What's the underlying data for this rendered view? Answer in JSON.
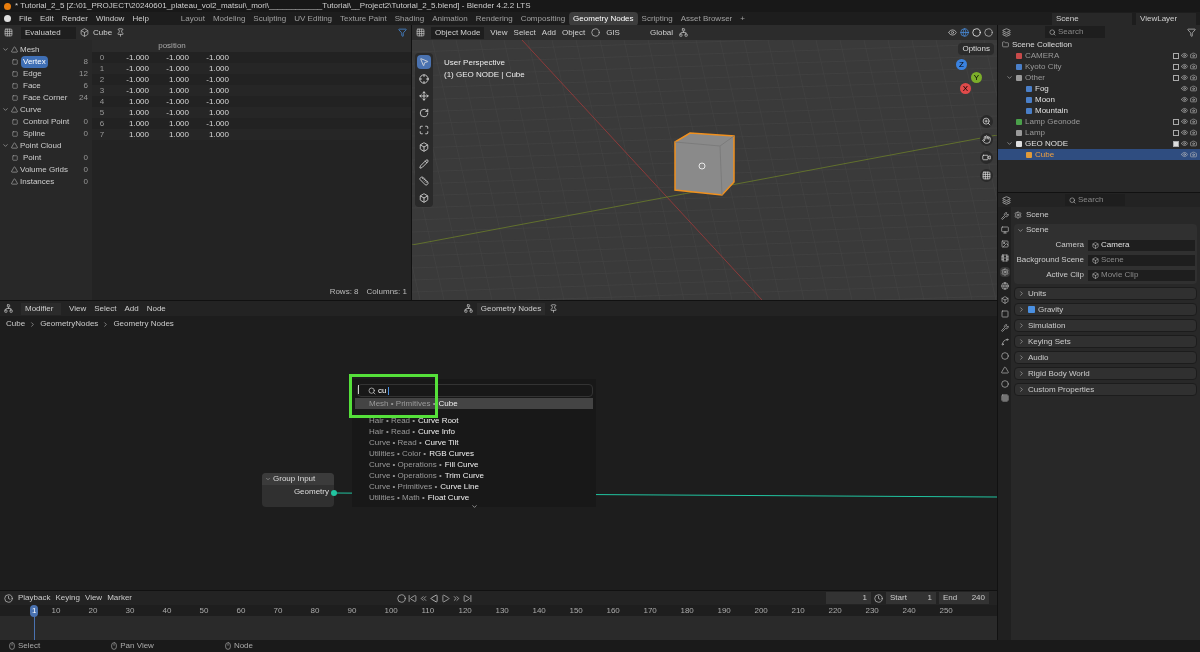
{
  "title_bar": {
    "title": "* Tutorial_2_5 [Z:\\01_PROJECT\\20240601_plateau_vol2_matsui\\_mori\\____________Tutorial\\__Project2\\Tutorial_2_5.blend] - Blender 4.2.2 LTS"
  },
  "menu": [
    "File",
    "Edit",
    "Render",
    "Window",
    "Help"
  ],
  "workspaces": [
    {
      "label": "Layout",
      "selected": false
    },
    {
      "label": "Modeling",
      "selected": false
    },
    {
      "label": "Sculpting",
      "selected": false
    },
    {
      "label": "UV Editing",
      "selected": false
    },
    {
      "label": "Texture Paint",
      "selected": false
    },
    {
      "label": "Shading",
      "selected": false
    },
    {
      "label": "Animation",
      "selected": false
    },
    {
      "label": "Rendering",
      "selected": false
    },
    {
      "label": "Compositing",
      "selected": false
    },
    {
      "label": "Geometry Nodes",
      "selected": true
    },
    {
      "label": "Scripting",
      "selected": false
    },
    {
      "label": "Asset Browser",
      "selected": false
    }
  ],
  "add_workspace": "+",
  "scene": "Scene",
  "view_layer": "ViewLayer",
  "spreadsheet": {
    "mode": "Evaluated",
    "object": "Cube",
    "sidebar": [
      {
        "label": "Mesh",
        "expanded": true,
        "children": [
          {
            "label": "Vertex",
            "count": "8",
            "selected": true
          },
          {
            "label": "Edge",
            "count": "12",
            "selected": false
          },
          {
            "label": "Face",
            "count": "6",
            "selected": false
          },
          {
            "label": "Face Corner",
            "count": "24",
            "selected": false
          }
        ]
      },
      {
        "label": "Curve",
        "expanded": true,
        "children": [
          {
            "label": "Control Point",
            "count": "0",
            "selected": false
          },
          {
            "label": "Spline",
            "count": "0",
            "selected": false
          }
        ]
      },
      {
        "label": "Point Cloud",
        "expanded": true,
        "children": [
          {
            "label": "Point",
            "count": "0",
            "selected": false
          }
        ]
      },
      {
        "label": "Volume Grids",
        "count": "0",
        "selected": false
      },
      {
        "label": "Instances",
        "count": "0",
        "selected": false
      }
    ],
    "column": "position",
    "rows": [
      {
        "index": "0",
        "values": [
          "-1.000",
          "-1.000",
          "-1.000"
        ]
      },
      {
        "index": "1",
        "values": [
          "-1.000",
          "-1.000",
          "1.000"
        ]
      },
      {
        "index": "2",
        "values": [
          "-1.000",
          "1.000",
          "-1.000"
        ]
      },
      {
        "index": "3",
        "values": [
          "-1.000",
          "1.000",
          "1.000"
        ]
      },
      {
        "index": "4",
        "values": [
          "1.000",
          "-1.000",
          "-1.000"
        ]
      },
      {
        "index": "5",
        "values": [
          "1.000",
          "-1.000",
          "1.000"
        ]
      },
      {
        "index": "6",
        "values": [
          "1.000",
          "1.000",
          "-1.000"
        ]
      },
      {
        "index": "7",
        "values": [
          "1.000",
          "1.000",
          "1.000"
        ]
      }
    ],
    "footer": [
      "Rows: 8",
      "Columns: 1"
    ]
  },
  "viewport": {
    "mode": "Object Mode",
    "menus": [
      "View",
      "Select",
      "Add",
      "Object"
    ],
    "gis": "GIS",
    "orientation": "Global",
    "options": "Options",
    "overlay": [
      "User Perspective",
      "(1) GEO NODE | Cube"
    ],
    "gizmo": [
      "Z",
      "Y",
      "X"
    ]
  },
  "outliner": {
    "search_placeholder": "Search",
    "root": "Scene Collection",
    "items": [
      {
        "label": "CAMERA",
        "color": "#c84a4a",
        "checked": false,
        "selected": false
      },
      {
        "label": "Kyoto City",
        "color": "#4a7fc8",
        "checked": false,
        "selected": false
      },
      {
        "label": "Other",
        "color": "#9a9a9a",
        "checked": false,
        "expanded": true,
        "selected": false,
        "children": [
          {
            "label": "Fog",
            "color": "#4a7fc8",
            "selected": false
          },
          {
            "label": "Moon",
            "color": "#4a7fc8",
            "selected": false
          },
          {
            "label": "Mountain",
            "color": "#4a7fc8",
            "selected": false
          }
        ]
      },
      {
        "label": "Lamp Geonode",
        "color": "#4aa04a",
        "checked": false,
        "selected": false
      },
      {
        "label": "Lamp",
        "color": "#9a9a9a",
        "checked": false,
        "selected": false
      },
      {
        "label": "GEO NODE",
        "color": "#e0e0e0",
        "checked": true,
        "expanded": true,
        "selected": false,
        "children": [
          {
            "label": "Cube",
            "color": "#e09a3a",
            "selected": true
          }
        ]
      }
    ]
  },
  "properties": {
    "search_placeholder": "Search",
    "context": "Scene",
    "panel": "Scene",
    "fields": [
      {
        "label": "Camera",
        "value": "Camera"
      },
      {
        "label": "Background Scene",
        "placeholder": "Scene"
      },
      {
        "label": "Active Clip",
        "placeholder": "Movie Clip"
      }
    ],
    "sections": [
      {
        "label": "Units",
        "kind": "plain"
      },
      {
        "label": "Gravity",
        "kind": "checkbox",
        "checked": true
      },
      {
        "label": "Simulation",
        "kind": "plain"
      },
      {
        "label": "Keying Sets",
        "kind": "plain"
      },
      {
        "label": "Audio",
        "kind": "plain"
      },
      {
        "label": "Rigid Body World",
        "kind": "plain"
      },
      {
        "label": "Custom Properties",
        "kind": "plain"
      }
    ]
  },
  "node_editor": {
    "editor": "Modifier",
    "menus": [
      "View",
      "Select",
      "Add",
      "Node"
    ],
    "tree": "Geometry Nodes",
    "breadcrumbs": [
      "Cube",
      "GeometryNodes",
      "Geometry Nodes"
    ],
    "node": {
      "title": "Group Input",
      "socket": "Geometry"
    },
    "search": {
      "query": "cu",
      "results": [
        {
          "path": "Mesh • Primitives •",
          "name": "Cube",
          "selected": true
        },
        {
          "path": "Hair • Read •",
          "name": "Curve Root",
          "selected": false
        },
        {
          "path": "Hair • Read •",
          "name": "Curve Info",
          "selected": false
        },
        {
          "path": "Curve • Read •",
          "name": "Curve Tilt",
          "selected": false
        },
        {
          "path": "Utilities • Color •",
          "name": "RGB Curves",
          "selected": false
        },
        {
          "path": "Curve • Operations •",
          "name": "Fill Curve",
          "selected": false
        },
        {
          "path": "Curve • Operations •",
          "name": "Trim Curve",
          "selected": false
        },
        {
          "path": "Curve • Primitives •",
          "name": "Curve Line",
          "selected": false
        },
        {
          "path": "Utilities • Math •",
          "name": "Float Curve",
          "selected": false
        }
      ]
    }
  },
  "timeline": {
    "menus": [
      "Playback",
      "Keying",
      "View",
      "Marker"
    ],
    "current_frame": "1",
    "playhead_frame": "1",
    "start_label": "Start",
    "start": "1",
    "end_label": "End",
    "end": "240",
    "ticks": [
      "10",
      "20",
      "30",
      "40",
      "50",
      "60",
      "70",
      "80",
      "90",
      "100",
      "110",
      "120",
      "130",
      "140",
      "150",
      "160",
      "170",
      "180",
      "190",
      "200",
      "210",
      "220",
      "230",
      "240",
      "250"
    ]
  },
  "status_bar": [
    "Select",
    "Pan View",
    "Node"
  ]
}
